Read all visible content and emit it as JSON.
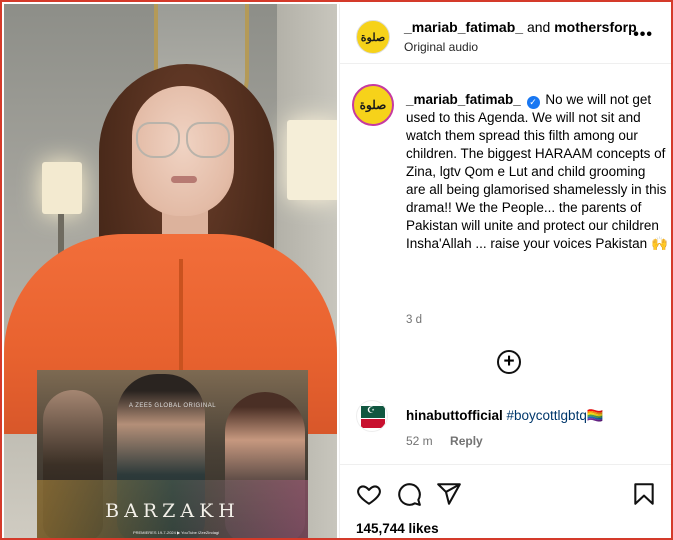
{
  "header": {
    "username": "_mariab_fatimab_",
    "and_text": "and",
    "collaborator": "mothersforp",
    "audio": "Original audio",
    "more": "•••",
    "avatar_text": "صلوة"
  },
  "caption": {
    "username": "_mariab_fatimab_",
    "verified": "✓",
    "text": "No we will not get used to this Agenda. We will not sit and watch them spread this filth among our children. The biggest HARAAM concepts of Zina, lgtv Qom e Lut and child grooming are all being glamorised shamelessly in this drama!! We the People... the parents of Pakistan will unite and protect our children Insha'Allah ... raise your voices Pakistan 🙌",
    "time": "3 d",
    "avatar_text": "صلوة"
  },
  "load_more": "+",
  "comment": {
    "username": "hinabuttofficial",
    "text": "#boycottlgbtq🏳️‍🌈",
    "time": "52 m",
    "reply": "Reply",
    "flag_symbol": "☪"
  },
  "likes": "145,744 likes",
  "poster": {
    "network": "A ZEE5 GLOBAL ORIGINAL",
    "title": "BARZAKH",
    "footer": "PREMIERES 19-7-2024 ▶ YouTube /ZeeZindagi"
  },
  "icons": [
    "more-icon",
    "verified-icon",
    "plus-circle-icon",
    "heart-icon",
    "comment-icon",
    "share-icon",
    "bookmark-icon"
  ],
  "colors": {
    "verified": "#1877f2",
    "avatar": "#f6d21a",
    "shirt": "#e8622f"
  }
}
